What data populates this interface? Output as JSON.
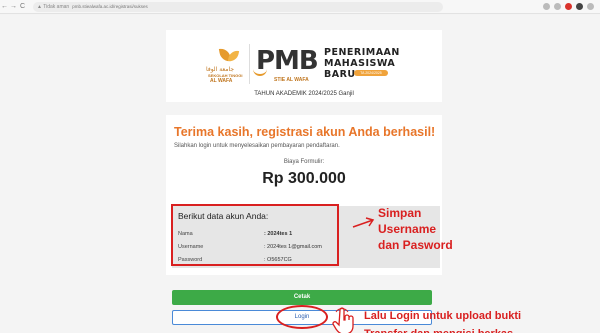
{
  "browser": {
    "back_icon": "←",
    "forward_icon": "→",
    "reload_icon": "C",
    "security_label": "▲ Tidak aman",
    "address": "pmb.stiealwafa.ac.id/registrasi/sukses",
    "extension_icons": [
      "bookmark-icon",
      "share-icon",
      "extension-icon",
      "profile-icon",
      "menu-icon"
    ]
  },
  "header": {
    "logo_arabic": "جامعة الوفا",
    "logo_line1": "SEKOLAH TINGGI",
    "logo_line2": "AL WAFA",
    "pmb": "PMB",
    "pmb_sub": "STIE AL WAFA",
    "title_line1": "PENERIMAAN",
    "title_line2": "MAHASISWA",
    "title_line3": "BARU",
    "year_badge": "TA 2024/2025",
    "academic_year": "TAHUN AKADEMIK 2024/2025 Ganjil"
  },
  "main": {
    "success_title": "Terima kasih, registrasi akun Anda berhasil!",
    "instruction": "Silahkan login untuk menyelesaikan pembayaran pendaftaran.",
    "fee_label": "Biaya Formulir:",
    "fee_amount": "Rp 300.000"
  },
  "account": {
    "title": "Berikut data akun Anda:",
    "rows": [
      {
        "label": "Nama",
        "value": ": 2024tes 1"
      },
      {
        "label": "Username",
        "value": ": 2024tes 1@gmail.com"
      },
      {
        "label": "Password",
        "value": ": O5657CG"
      }
    ]
  },
  "annotations": {
    "save_line1": "Simpan",
    "save_line2": "Username",
    "save_line3": "dan Pasword",
    "login_line1": "Lalu Login untuk upload bukti",
    "login_line2": "Transfer dan mengisi berkas"
  },
  "buttons": {
    "print": "Cetak",
    "login": "Login"
  },
  "colors": {
    "accent_orange": "#e8762a",
    "annotation_red": "#d92020",
    "print_green": "#3daa47",
    "login_blue": "#4a8ad8"
  }
}
